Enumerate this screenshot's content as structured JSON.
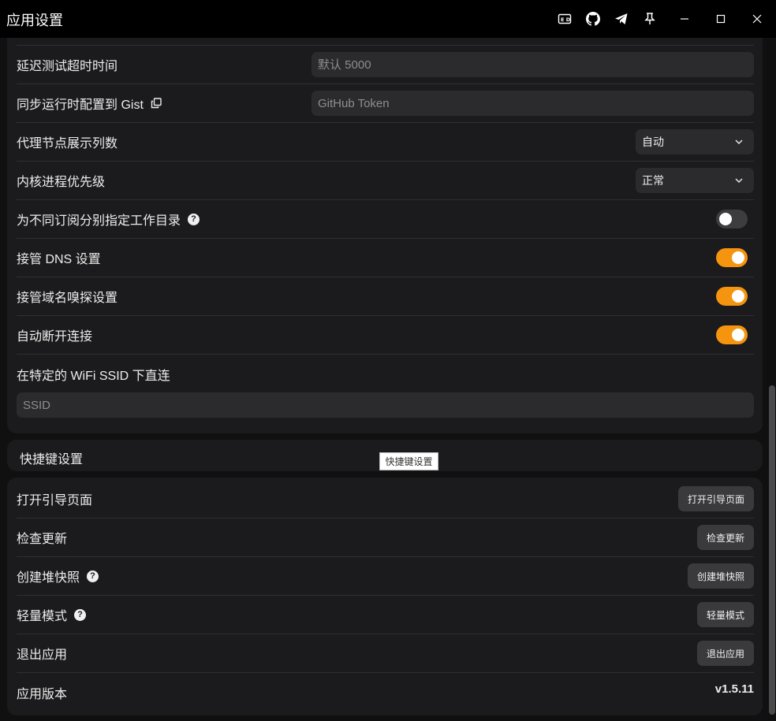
{
  "window": {
    "title": "应用设置",
    "icons": [
      "ed-icon",
      "github-icon",
      "telegram-icon",
      "pin-icon",
      "minimize-icon",
      "maximize-icon",
      "close-icon"
    ]
  },
  "settings": {
    "delay_timeout": {
      "label": "延迟测试超时时间",
      "placeholder": "默认 5000"
    },
    "sync_gist": {
      "label": "同步运行时配置到 Gist",
      "placeholder": "GitHub Token"
    },
    "proxy_columns": {
      "label": "代理节点展示列数",
      "value": "自动"
    },
    "core_priority": {
      "label": "内核进程优先级",
      "value": "正常"
    },
    "sub_workdir": {
      "label": "为不同订阅分别指定工作目录",
      "help": "?",
      "enabled": false
    },
    "takeover_dns": {
      "label": "接管 DNS 设置",
      "enabled": true
    },
    "takeover_sniff": {
      "label": "接管域名嗅探设置",
      "enabled": true
    },
    "auto_disconnect": {
      "label": "自动断开连接",
      "enabled": true
    },
    "wifi_direct": {
      "label": "在特定的 WiFi SSID 下直连",
      "placeholder": "SSID"
    }
  },
  "shortcuts": {
    "title": "快捷键设置",
    "tooltip": "快捷键设置"
  },
  "actions": {
    "open_guide": {
      "label": "打开引导页面",
      "button": "打开引导页面"
    },
    "check_update": {
      "label": "检查更新",
      "button": "检查更新"
    },
    "heap_snapshot": {
      "label": "创建堆快照",
      "help": "?",
      "button": "创建堆快照"
    },
    "lite_mode": {
      "label": "轻量模式",
      "help": "?",
      "button": "轻量模式"
    },
    "quit_app": {
      "label": "退出应用",
      "button": "退出应用"
    },
    "version": {
      "label": "应用版本",
      "value": "v1.5.11"
    }
  },
  "colors": {
    "accent": "#f5940f",
    "background": "#101010",
    "card": "#1b1b1d"
  }
}
